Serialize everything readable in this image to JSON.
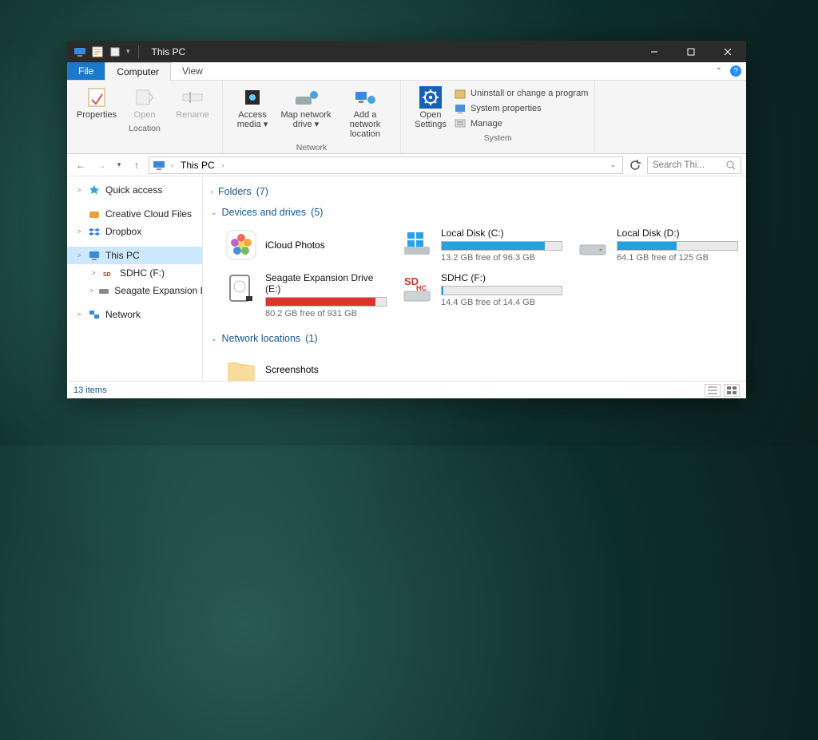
{
  "titlebar": {
    "title": "This PC"
  },
  "tabs": {
    "file": "File",
    "computer": "Computer",
    "view": "View"
  },
  "ribbon": {
    "location": {
      "label": "Location",
      "properties": "Properties",
      "open": "Open",
      "rename": "Rename"
    },
    "network": {
      "label": "Network",
      "access_media": "Access media",
      "map_drive": "Map network drive",
      "add_location": "Add a network location"
    },
    "system": {
      "label": "System",
      "open_settings": "Open Settings",
      "uninstall": "Uninstall or change a program",
      "properties": "System properties",
      "manage": "Manage"
    }
  },
  "address": {
    "crumb": "This PC"
  },
  "search": {
    "placeholder": "Search Thi..."
  },
  "sidebar": {
    "items": [
      {
        "label": "Quick access",
        "icon": "star-icon",
        "color": "#3ca0e7",
        "exp": ">"
      },
      {
        "label": "Creative Cloud Files",
        "icon": "cc-icon",
        "color": "#e8a13a",
        "exp": ""
      },
      {
        "label": "Dropbox",
        "icon": "dropbox-icon",
        "color": "#2f7de1",
        "exp": ">"
      },
      {
        "label": "This PC",
        "icon": "pc-icon",
        "color": "#3a89d8",
        "exp": ">",
        "active": true
      },
      {
        "label": "SDHC (F:)",
        "icon": "sdhc-icon",
        "color": "#b02a2a",
        "exp": ">",
        "sub": true
      },
      {
        "label": "Seagate Expansion Drive (E:)",
        "icon": "hdd-icon",
        "color": "#8a8a8a",
        "exp": ">",
        "sub": true
      },
      {
        "label": "Network",
        "icon": "network-icon",
        "color": "#3a89d8",
        "exp": ">"
      }
    ]
  },
  "groups": {
    "folders": {
      "label": "Folders",
      "count": "(7)",
      "collapsed": true
    },
    "devices": {
      "label": "Devices and drives",
      "count": "(5)"
    },
    "netloc": {
      "label": "Network locations",
      "count": "(1)"
    }
  },
  "devices": [
    {
      "kind": "simple",
      "name": "iCloud Photos",
      "icon": "photos-icon"
    },
    {
      "kind": "drive",
      "name": "Local Disk (C:)",
      "icon": "windows-drive-icon",
      "free": "13.2 GB free of 96.3 GB",
      "fill_pct": 86,
      "color": "blue"
    },
    {
      "kind": "drive",
      "name": "Local Disk (D:)",
      "icon": "drive-icon",
      "free": "64.1 GB free of 125 GB",
      "fill_pct": 49,
      "color": "blue"
    },
    {
      "kind": "drive",
      "name": "Seagate Expansion Drive (E:)",
      "icon": "ext-hdd-icon",
      "free": "80.2 GB free of 931 GB",
      "fill_pct": 91,
      "color": "red"
    },
    {
      "kind": "drive",
      "name": "SDHC (F:)",
      "icon": "sdhc-drive-icon",
      "free": "14.4 GB free of 14.4 GB",
      "fill_pct": 1,
      "color": "blue"
    }
  ],
  "netloc_items": [
    {
      "name": "Screenshots",
      "icon": "folder-icon"
    }
  ],
  "status": {
    "count": "13 items"
  }
}
